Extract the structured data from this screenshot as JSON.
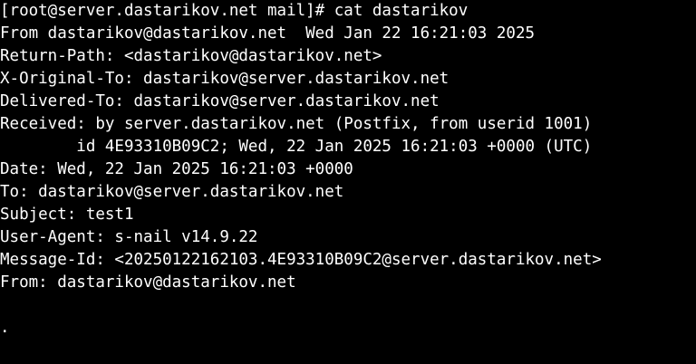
{
  "terminal": {
    "lines": [
      "[root@server.dastarikov.net mail]# cat dastarikov",
      "From dastarikov@dastarikov.net  Wed Jan 22 16:21:03 2025",
      "Return-Path: <dastarikov@dastarikov.net>",
      "X-Original-To: dastarikov@server.dastarikov.net",
      "Delivered-To: dastarikov@server.dastarikov.net",
      "Received: by server.dastarikov.net (Postfix, from userid 1001)",
      "        id 4E93310B09C2; Wed, 22 Jan 2025 16:21:03 +0000 (UTC)",
      "Date: Wed, 22 Jan 2025 16:21:03 +0000",
      "To: dastarikov@server.dastarikov.net",
      "Subject: test1",
      "User-Agent: s-nail v14.9.22",
      "Message-Id: <20250122162103.4E93310B09C2@server.dastarikov.net>",
      "From: dastarikov@dastarikov.net",
      "",
      "."
    ]
  }
}
